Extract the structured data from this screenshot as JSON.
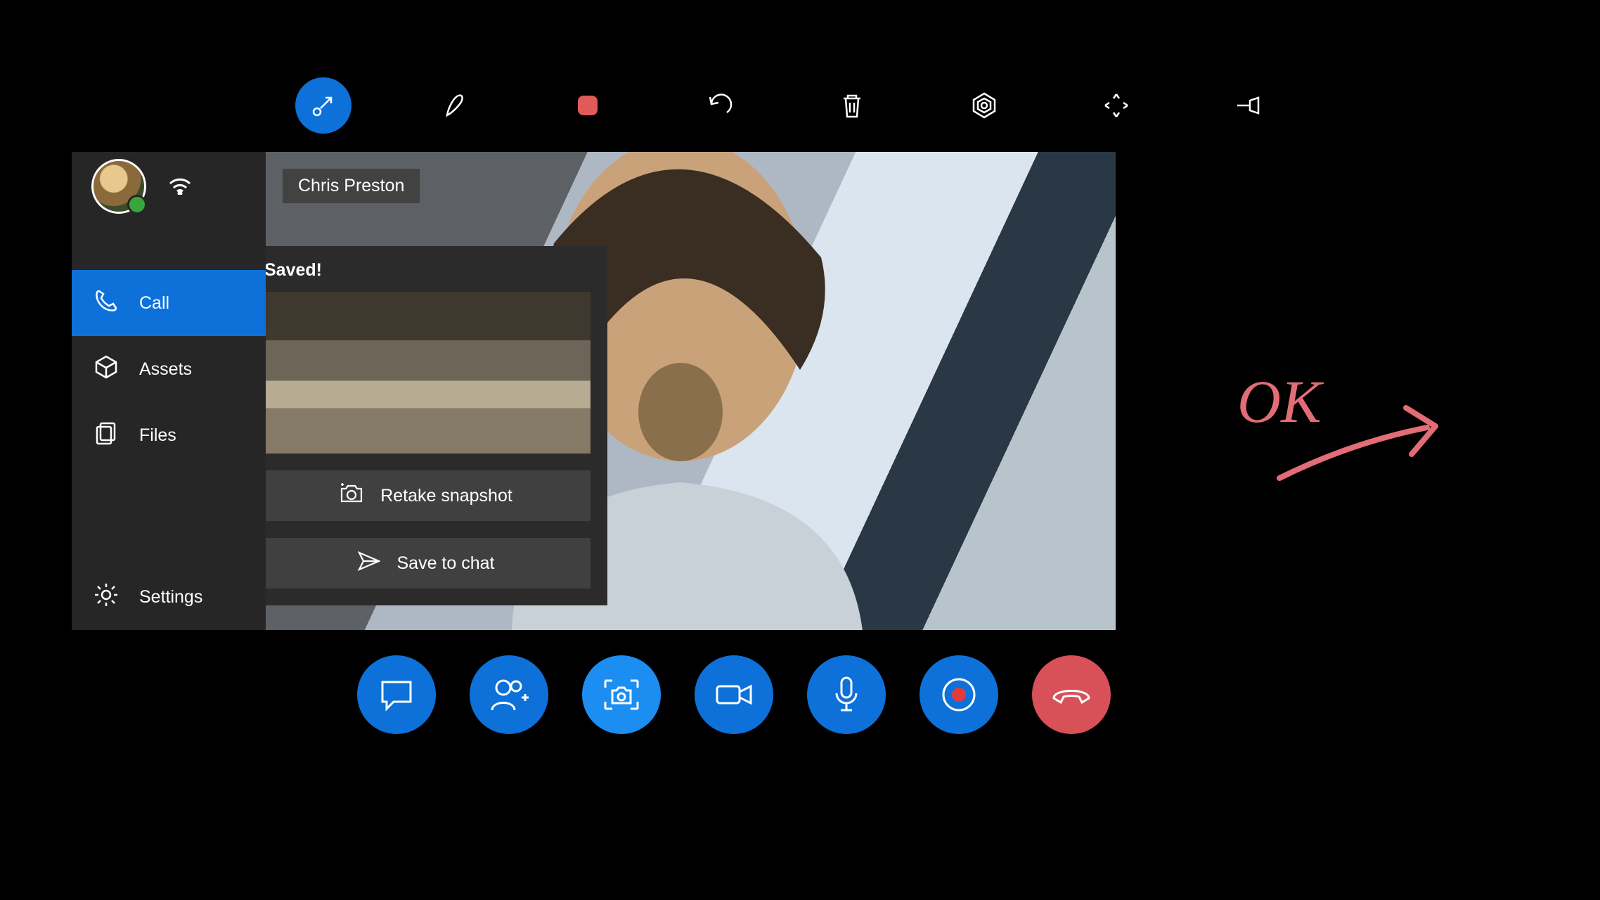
{
  "toolbar": {
    "items": [
      {
        "id": "minimize",
        "name": "minimize-icon",
        "interactable": true,
        "active": true
      },
      {
        "id": "pen",
        "name": "pen-icon",
        "interactable": true,
        "active": false
      },
      {
        "id": "stop",
        "name": "stop-record-icon",
        "interactable": true,
        "active": false,
        "color": "#e05a5a"
      },
      {
        "id": "undo",
        "name": "undo-icon",
        "interactable": true,
        "active": false
      },
      {
        "id": "trash",
        "name": "trash-icon",
        "interactable": true,
        "active": false
      },
      {
        "id": "hololens",
        "name": "hololens-icon",
        "interactable": true,
        "active": false
      },
      {
        "id": "grab",
        "name": "move-icon",
        "interactable": true,
        "active": false
      },
      {
        "id": "pin",
        "name": "pin-icon",
        "interactable": true,
        "active": false
      }
    ]
  },
  "sidebar": {
    "items": [
      {
        "id": "call",
        "label": "Call",
        "icon": "phone-icon",
        "active": true
      },
      {
        "id": "assets",
        "label": "Assets",
        "icon": "package-icon",
        "active": false
      },
      {
        "id": "files",
        "label": "Files",
        "icon": "files-icon",
        "active": false
      }
    ],
    "settings_label": "Settings"
  },
  "video": {
    "participant_name": "Chris Preston"
  },
  "snapshot": {
    "status_label": "Saved!",
    "retake_label": "Retake snapshot",
    "save_label": "Save to chat"
  },
  "callbar": {
    "items": [
      {
        "id": "chat",
        "name": "chat-icon",
        "color": "blue"
      },
      {
        "id": "people",
        "name": "add-people-icon",
        "color": "blue"
      },
      {
        "id": "snapshot",
        "name": "snapshot-icon",
        "color": "blue light"
      },
      {
        "id": "video",
        "name": "video-icon",
        "color": "blue"
      },
      {
        "id": "mic",
        "name": "mic-icon",
        "color": "blue"
      },
      {
        "id": "record",
        "name": "record-icon",
        "color": "blue"
      },
      {
        "id": "hangup",
        "name": "hangup-icon",
        "color": "red"
      }
    ]
  },
  "ink": {
    "text": "OK"
  }
}
